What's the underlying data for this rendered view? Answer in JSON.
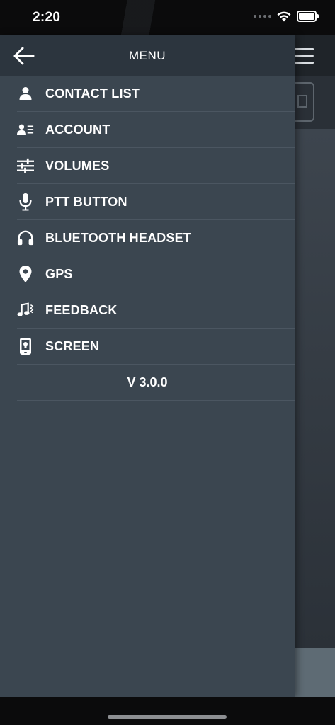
{
  "status_bar": {
    "time": "2:20"
  },
  "drawer": {
    "title": "MENU",
    "items": [
      {
        "label": "CONTACT LIST",
        "icon": "person-icon"
      },
      {
        "label": "ACCOUNT",
        "icon": "account-card-icon"
      },
      {
        "label": "VOLUMES",
        "icon": "sliders-icon"
      },
      {
        "label": "PTT BUTTON",
        "icon": "microphone-icon"
      },
      {
        "label": "BLUETOOTH HEADSET",
        "icon": "headphones-icon"
      },
      {
        "label": "GPS",
        "icon": "location-pin-icon"
      },
      {
        "label": "FEEDBACK",
        "icon": "music-note-icon"
      },
      {
        "label": "SCREEN",
        "icon": "phone-screen-icon"
      }
    ],
    "version": "V 3.0.0"
  },
  "colors": {
    "drawer_bg": "#3b4650",
    "drawer_header_bg": "#2c353e",
    "text": "#ffffff"
  }
}
